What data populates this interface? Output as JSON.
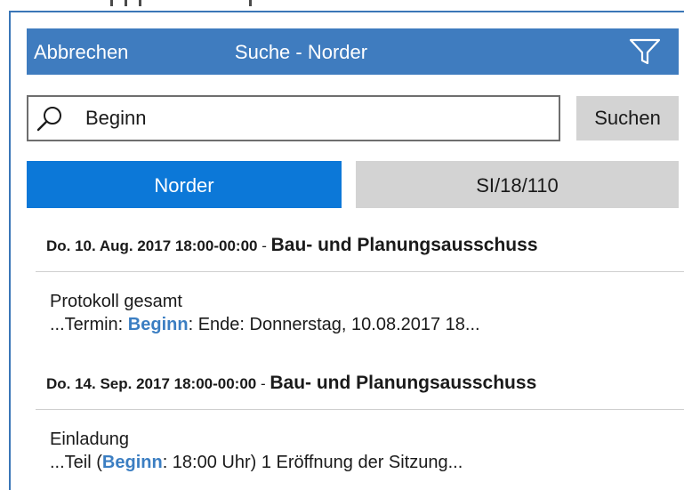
{
  "header": {
    "cancel_label": "Abbrechen",
    "title": "Suche - Norder",
    "filter_icon": "filter-icon"
  },
  "search": {
    "value": "Beginn",
    "button_label": "Suchen",
    "icon": "search-icon"
  },
  "tabs": [
    {
      "label": "Norder",
      "active": true
    },
    {
      "label": "SI/18/110",
      "active": false
    }
  ],
  "results": [
    {
      "date": "Do. 10. Aug. 2017 18:00-00:00",
      "separator": " - ",
      "committee": "Bau- und Planungsausschuss",
      "title": "Protokoll gesamt",
      "snippet_before": "...Termin: ",
      "snippet_hit": "Beginn",
      "snippet_after": ": Ende: Donnerstag, 10.08.2017 18..."
    },
    {
      "date": "Do. 14. Sep. 2017 18:00-00:00",
      "separator": " - ",
      "committee": "Bau- und Planungsausschuss",
      "title": "Einladung",
      "snippet_before": "...Teil (",
      "snippet_hit": "Beginn",
      "snippet_after": ": 18:00 Uhr) 1 Eröffnung der Sitzung..."
    }
  ],
  "colors": {
    "titlebar": "#3f7cbf",
    "active_tab": "#0c78d8",
    "inactive_tab": "#d3d3d3",
    "hit_highlight": "#3b7ec2"
  }
}
